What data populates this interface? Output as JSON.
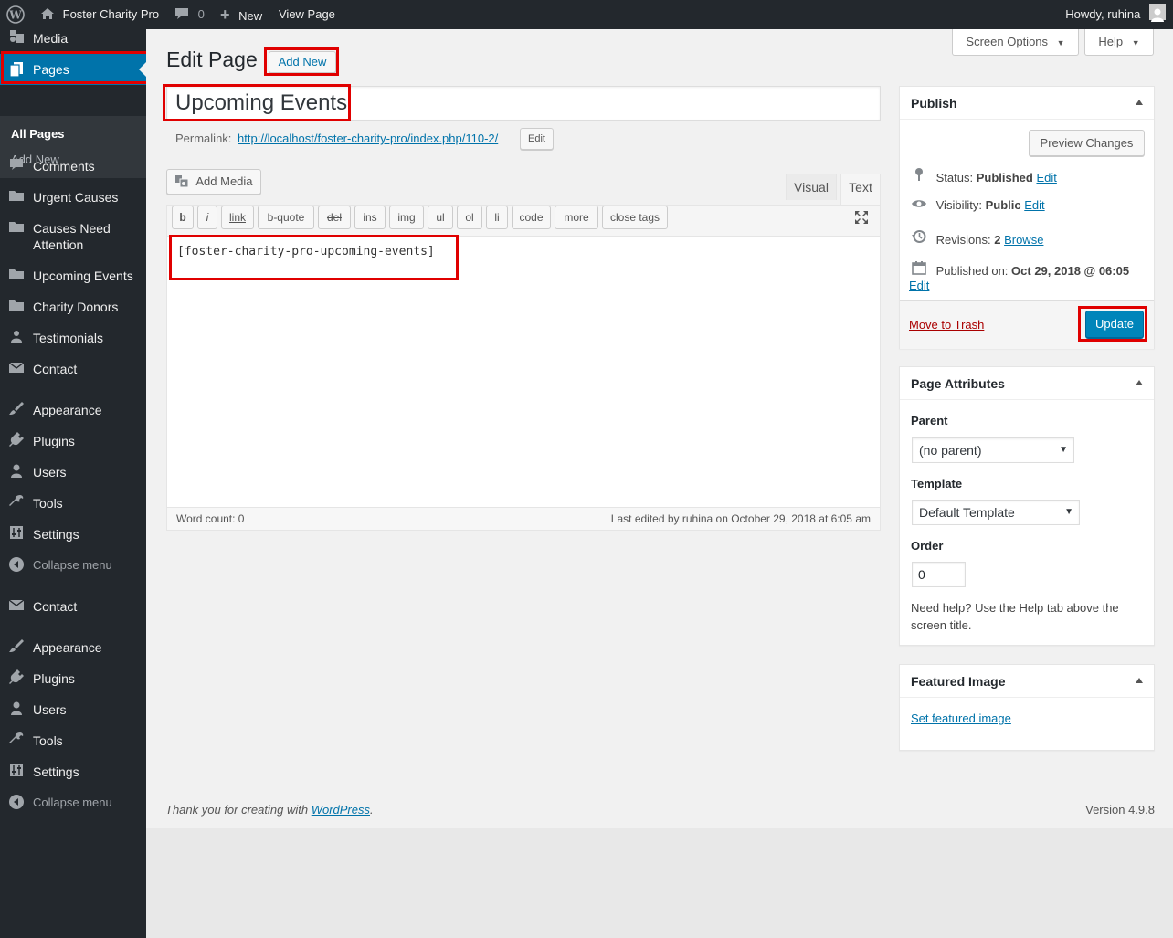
{
  "adminbar": {
    "site_name": "Foster Charity Pro",
    "comments_count": "0",
    "new_label": "New",
    "view_page_label": "View Page",
    "howdy": "Howdy, ruhina"
  },
  "sidebar": {
    "media": "Media",
    "pages": "Pages",
    "all_pages": "All Pages",
    "add_new": "Add New",
    "comments": "Comments",
    "urgent_causes": "Urgent Causes",
    "causes_need_attention": "Causes Need Attention",
    "upcoming_events": "Upcoming Events",
    "charity_donors": "Charity Donors",
    "testimonials": "Testimonials",
    "contact": "Contact",
    "appearance": "Appearance",
    "plugins": "Plugins",
    "users": "Users",
    "tools": "Tools",
    "settings": "Settings",
    "collapse_menu": "Collapse menu",
    "contact_2": "Contact",
    "appearance_2": "Appearance",
    "plugins_2": "Plugins",
    "users_2": "Users",
    "tools_2": "Tools",
    "settings_2": "Settings",
    "collapse_menu_2": "Collapse menu"
  },
  "screen_meta": {
    "screen_options": "Screen Options",
    "help": "Help"
  },
  "heading": {
    "title": "Edit Page",
    "add_new": "Add New"
  },
  "post": {
    "title": "Upcoming Events",
    "permalink_label": "Permalink:",
    "permalink_url": "http://localhost/foster-charity-pro/index.php/110-2/",
    "permalink_edit": "Edit"
  },
  "editor": {
    "add_media": "Add Media",
    "tab_visual": "Visual",
    "tab_text": "Text",
    "quicktags": [
      "b",
      "i",
      "link",
      "b-quote",
      "del",
      "ins",
      "img",
      "ul",
      "ol",
      "li",
      "code",
      "more",
      "close tags"
    ],
    "content": "[foster-charity-pro-upcoming-events]",
    "word_count": "Word count: 0",
    "last_edited": "Last edited by ruhina on October 29, 2018 at 6:05 am"
  },
  "publish": {
    "title": "Publish",
    "preview_changes": "Preview Changes",
    "status_label": "Status:",
    "status_value": "Published",
    "status_edit": "Edit",
    "visibility_label": "Visibility:",
    "visibility_value": "Public",
    "visibility_edit": "Edit",
    "revisions_label": "Revisions:",
    "revisions_value": "2",
    "revisions_browse": "Browse",
    "published_on_label": "Published on:",
    "published_on_value": "Oct 29, 2018 @ 06:05",
    "published_edit": "Edit",
    "move_to_trash": "Move to Trash",
    "update": "Update"
  },
  "page_attributes": {
    "title": "Page Attributes",
    "parent_label": "Parent",
    "parent_value": "(no parent)",
    "template_label": "Template",
    "template_value": "Default Template",
    "order_label": "Order",
    "order_value": "0",
    "help_text": "Need help? Use the Help tab above the screen title."
  },
  "featured_image": {
    "title": "Featured Image",
    "set_link": "Set featured image"
  },
  "footer": {
    "thanks_prefix": "Thank you for creating with ",
    "wordpress": "WordPress",
    "thanks_suffix": ".",
    "version": "Version 4.9.8"
  },
  "colors": {
    "admin_dark": "#23282d",
    "accent_blue": "#0073aa",
    "highlight_red": "#e00000"
  }
}
